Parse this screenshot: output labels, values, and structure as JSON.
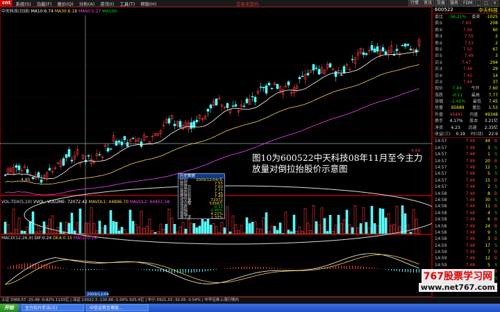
{
  "menubar": {
    "logo": "cnt",
    "items": [
      "系统(S)",
      "功能(F)",
      "报价(Q)",
      "分析(A)",
      "资讯(I)",
      "工具(T)",
      "帮助(H)"
    ],
    "center_title": "交易未签约",
    "right_buttons": [
      "行情",
      "资讯",
      "交易",
      "服务",
      "FDM",
      "_",
      "□",
      "×"
    ]
  },
  "price_legend": {
    "title": "中天科技(日线)",
    "ma1": "MA10:6.74",
    "ma2": "MA30:6.18",
    "ma3": "MA60:5.27",
    "ma4": "MA100:"
  },
  "vol_legend": {
    "title": "VOL-TDX(5,10)",
    "vvol": "VVOL:",
    "volume": "VOLUME: 72072.42",
    "mavol1": "MAVOL1: 44896.70",
    "mavol2": "MAVOL2: 64451.58"
  },
  "macd_legend": {
    "title": "MACD(12,26,9)",
    "dif": "DIF:0.24",
    "dea": "DEA:0.15",
    "macd": "MACD:0.18"
  },
  "price_labels": {
    "low_mark": "4.95",
    "axis_low": "-4.66",
    "date_tag": "2009/12/04"
  },
  "overlay_text": {
    "line1": "图10为600522中天科技08年11月至今主力",
    "line2": "放量对倒拉抬股价示意图"
  },
  "info_box": {
    "title": "历史数据",
    "rows": [
      {
        "k": "时间",
        "v": "2009/12/04/五"
      },
      {
        "k": "数值",
        "v": "7.55"
      },
      {
        "k": "开盘价",
        "v": "7.60"
      },
      {
        "k": "最高价",
        "v": "7.77"
      },
      {
        "k": "最低价",
        "v": "7.45"
      },
      {
        "k": "收盘价",
        "v": "7.49"
      },
      {
        "k": "成交量",
        "v": "72072"
      },
      {
        "k": "成交额",
        "v": "5358万"
      },
      {
        "k": "涨跌",
        "v": "-0.11"
      },
      {
        "k": "涨幅",
        "v": "-1.45%"
      },
      {
        "k": "振幅",
        "v": "4.21%"
      },
      {
        "k": "换手率",
        "v": "1.33%"
      }
    ]
  },
  "right_panel": {
    "code": "600522",
    "name": "中天科技",
    "quote_rows": [
      {
        "l": "委比",
        "v": "-56.21%",
        "l2": "委差",
        "v2": "-1025",
        "c": "green"
      },
      {
        "l": "卖⑤",
        "v": "7.60",
        "v2": "208",
        "c": "red"
      },
      {
        "l": "卖④",
        "v": "7.56",
        "v2": "60",
        "c": "red"
      },
      {
        "l": "卖③",
        "v": "7.55",
        "v2": "2",
        "c": "red"
      },
      {
        "l": "卖②",
        "v": "7.53",
        "v2": "2",
        "c": "red"
      },
      {
        "l": "卖①",
        "v": "7.50",
        "v2": "67",
        "c": "red"
      },
      {
        "l": "买①",
        "v": "7.49",
        "v2": "3",
        "c": "red"
      },
      {
        "l": "买②",
        "v": "7.47",
        "v2": "294",
        "c": "red"
      },
      {
        "l": "买③",
        "v": "7.46",
        "v2": "29",
        "c": "red"
      },
      {
        "l": "买④",
        "v": "7.45",
        "v2": "14",
        "c": "red"
      },
      {
        "l": "买⑤",
        "v": "7.44",
        "v2": "37",
        "c": "red"
      },
      {
        "l": "现价",
        "v": "7.49",
        "l2": "今开",
        "v2": "7.60",
        "c": "green"
      },
      {
        "l": "涨跌",
        "v": "-0.11",
        "l2": "最高",
        "v2": "7.77",
        "c": "green"
      },
      {
        "l": "涨幅",
        "v": "-1.45%",
        "l2": "最低",
        "v2": "7.45",
        "c": "green"
      },
      {
        "l": "总量",
        "v": "95689",
        "l2": "量比",
        "v2": "1.53",
        "c": "yel"
      },
      {
        "l": "外盘",
        "v": "45441",
        "l2": "内盘",
        "v2": "49348",
        "c": "red"
      },
      {
        "l": "换手",
        "v": "4.17%",
        "l2": "股本",
        "v2": "3.21亿",
        "c": "white"
      },
      {
        "l": "净资",
        "v": "4.23",
        "l2": "流通",
        "v2": "2.33亿",
        "c": "white"
      },
      {
        "l": "收益(三)",
        "v": "0.19",
        "l2": "PE(动)",
        "v2": "22.9",
        "c": "white"
      }
    ],
    "trades": [
      {
        "t": "14:57",
        "p": "7.49",
        "v": "44",
        "s": "B"
      },
      {
        "t": "14:57",
        "p": "7.48",
        "v": "3",
        "s": "S"
      },
      {
        "t": "14:57",
        "p": "7.48",
        "v": "1",
        "s": "S"
      },
      {
        "t": "14:57",
        "p": "7.49",
        "v": "20",
        "s": "B"
      },
      {
        "t": "14:57",
        "p": "7.48",
        "v": "12",
        "s": "S"
      },
      {
        "t": "14:57",
        "p": "7.48",
        "v": "5",
        "s": "S"
      },
      {
        "t": "14:57",
        "p": "7.49",
        "v": "15",
        "s": "B"
      },
      {
        "t": "14:57",
        "p": "7.48",
        "v": "2",
        "s": "S"
      },
      {
        "t": "14:58",
        "p": "7.49",
        "v": "8",
        "s": "B"
      },
      {
        "t": "14:58",
        "p": "7.48",
        "v": "30",
        "s": "S"
      },
      {
        "t": "14:58",
        "p": "7.49",
        "v": "11",
        "s": "B"
      },
      {
        "t": "14:58",
        "p": "7.48",
        "v": "4",
        "s": "S"
      },
      {
        "t": "14:58",
        "p": "7.49",
        "v": "6",
        "s": "B"
      },
      {
        "t": "14:58",
        "p": "7.49",
        "v": "24",
        "s": "B"
      },
      {
        "t": "14:58",
        "p": "7.48",
        "v": "9",
        "s": "S"
      },
      {
        "t": "14:58",
        "p": "7.49",
        "v": "3",
        "s": "B"
      },
      {
        "t": "14:59",
        "p": "7.48",
        "v": "17",
        "s": "S"
      },
      {
        "t": "14:59",
        "p": "7.49",
        "v": "7",
        "s": "B"
      },
      {
        "t": "14:59",
        "p": "7.49",
        "v": "12",
        "s": "B"
      },
      {
        "t": "14:59",
        "p": "7.48",
        "v": "5",
        "s": "S"
      },
      {
        "t": "14:59",
        "p": "7.49",
        "v": "22",
        "s": "B"
      },
      {
        "t": "15:00",
        "p": "7.49",
        "v": "86",
        "s": "S"
      }
    ]
  },
  "watermark": {
    "logo": "767股票学习网",
    "url": "www.net767.com"
  },
  "statusbar": {
    "text": "上证 3368.57  -25.48  -0.82%  1133亿  |  深证 13022.3  -130.66  -1.00%  925.4亿  |  中小 5921.33  -32.05  -0.54%  |  中华证券上海行情内"
  },
  "taskbar": {
    "start": "开始",
    "items": [
      "主力拉升手法(三)",
      "中信证券至尊版..."
    ]
  },
  "colors": {
    "up": "#ff3c3c",
    "down": "#54ffff",
    "ma10": "#ffffff",
    "ma30": "#ffd84a",
    "ma60": "#ff40ff",
    "grid": "#800000"
  }
}
